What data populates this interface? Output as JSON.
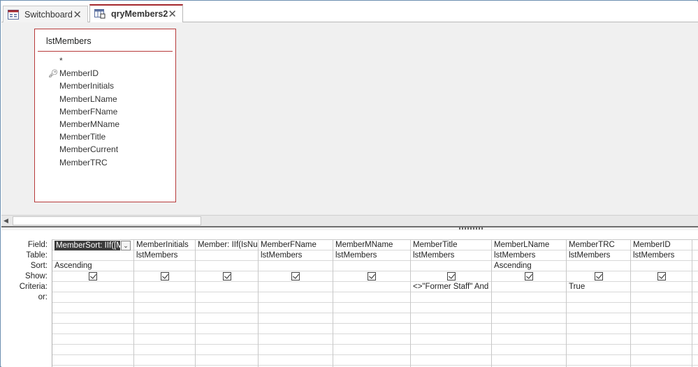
{
  "tabs": [
    {
      "label": "Switchboard",
      "icon": "form-icon",
      "active": false
    },
    {
      "label": "qryMembers2",
      "icon": "query-icon",
      "active": true
    }
  ],
  "field_list": {
    "title": "lstMembers",
    "fields": [
      "*",
      "MemberID",
      "MemberInitials",
      "MemberLName",
      "MemberFName",
      "MemberMName",
      "MemberTitle",
      "MemberCurrent",
      "MemberTRC"
    ],
    "primary_key": "MemberID"
  },
  "grid": {
    "row_labels": [
      "Field:",
      "Table:",
      "Sort:",
      "Show:",
      "Criteria:",
      "or:"
    ],
    "columns": [
      {
        "field": "MemberSort: IIf([M",
        "table": "",
        "sort": "Ascending",
        "show": true,
        "criteria": "",
        "or": ""
      },
      {
        "field": "MemberInitials",
        "table": "lstMembers",
        "sort": "",
        "show": true,
        "criteria": "",
        "or": ""
      },
      {
        "field": "Member: IIf(IsNu",
        "table": "",
        "sort": "",
        "show": true,
        "criteria": "",
        "or": ""
      },
      {
        "field": "MemberFName",
        "table": "lstMembers",
        "sort": "",
        "show": true,
        "criteria": "",
        "or": ""
      },
      {
        "field": "MemberMName",
        "table": "lstMembers",
        "sort": "",
        "show": true,
        "criteria": "",
        "or": ""
      },
      {
        "field": "MemberTitle",
        "table": "lstMembers",
        "sort": "",
        "show": true,
        "criteria": "<>\"Former Staff\" And",
        "or": ""
      },
      {
        "field": "MemberLName",
        "table": "lstMembers",
        "sort": "Ascending",
        "show": true,
        "criteria": "",
        "or": ""
      },
      {
        "field": "MemberTRC",
        "table": "lstMembers",
        "sort": "",
        "show": true,
        "criteria": "True",
        "or": ""
      },
      {
        "field": "MemberID",
        "table": "lstMembers",
        "sort": "",
        "show": true,
        "criteria": "",
        "or": ""
      }
    ]
  },
  "colors": {
    "accent": "#a4262c",
    "table_border": "#b73a3a",
    "frame": "#6d8fb0"
  }
}
